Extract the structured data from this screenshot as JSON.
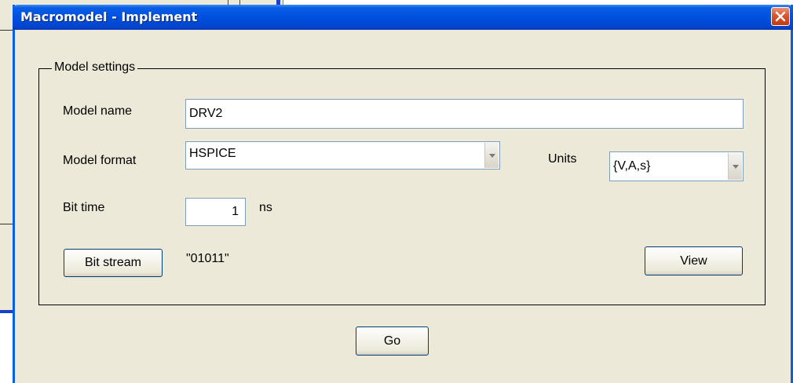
{
  "window": {
    "title": "Macromodel - Implement"
  },
  "group": {
    "label": "Model settings"
  },
  "model_name": {
    "label": "Model name",
    "value": "DRV2"
  },
  "model_format": {
    "label": "Model format",
    "value": "HSPICE"
  },
  "units": {
    "label": "Units",
    "value": "{V,A,s}"
  },
  "bit_time": {
    "label": "Bit time",
    "value": "1",
    "unit": "ns"
  },
  "bit_stream": {
    "button": "Bit stream",
    "value": "\"01011\""
  },
  "view_button": "View",
  "go_button": "Go",
  "icons": {
    "close": "close-icon",
    "dropdown": "chevron-down-icon"
  },
  "colors": {
    "titlebar": "#0050e0",
    "dialog_bg": "#ece9d8",
    "close": "#d9552d"
  }
}
